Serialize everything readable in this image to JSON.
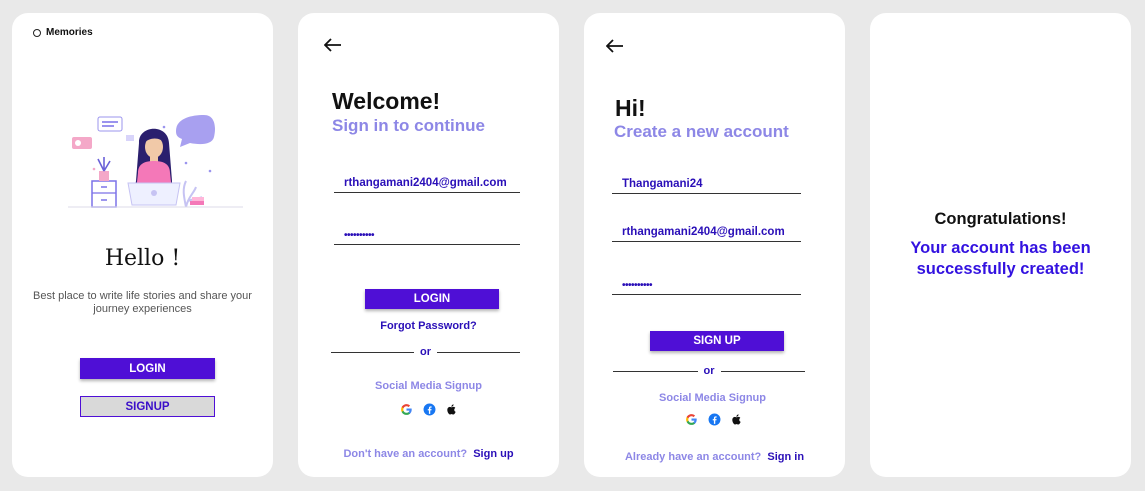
{
  "screen1": {
    "brand": "Memories",
    "title": "Hello !",
    "tagline": "Best place to write life stories and share your journey experiences",
    "login_label": "LOGIN",
    "signup_label": "SIGNUP"
  },
  "screen2": {
    "title": "Welcome!",
    "subtitle": "Sign in to continue",
    "email_value": "rthangamani2404@gmail.com",
    "password_value": "••••••••••",
    "login_label": "LOGIN",
    "forgot_label": "Forgot Password?",
    "or_label": "or",
    "social_label": "Social Media Signup",
    "bottom_text": "Don't  have an account?",
    "bottom_link": "Sign up"
  },
  "screen3": {
    "title": "Hi!",
    "subtitle": "Create a new account",
    "username_value": "Thangamani24",
    "email_value": "rthangamani2404@gmail.com",
    "password_value": "••••••••••",
    "signup_label": "SIGN UP",
    "or_label": "or",
    "social_label": "Social Media Signup",
    "bottom_text": "Already have an account?",
    "bottom_link": "Sign in"
  },
  "screen4": {
    "title": "Congratulations!",
    "message": "Your account has been successfully created!"
  },
  "icons": [
    "logo-ring-icon",
    "back-arrow-icon",
    "google-icon",
    "facebook-icon",
    "apple-icon"
  ],
  "colors": {
    "background": "#e9e9e9",
    "card": "#ffffff",
    "primary": "#4f0fd6",
    "accent_text": "#2a0fb8",
    "muted_purple": "#8d87e6",
    "success_blue": "#3312e0"
  }
}
